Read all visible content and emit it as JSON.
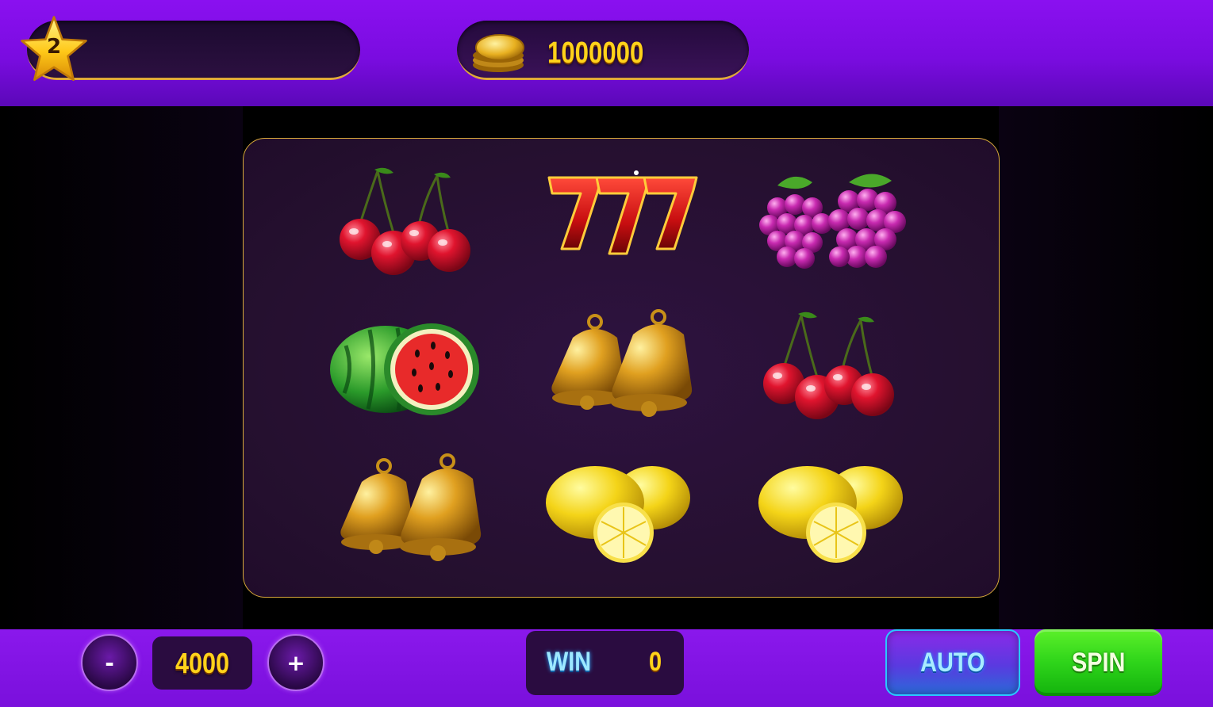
{
  "header": {
    "level": "2",
    "balance": "1000000"
  },
  "reels": {
    "symbols": [
      [
        "cherries",
        "sevens",
        "grapes"
      ],
      [
        "watermelon",
        "bells",
        "cherries"
      ],
      [
        "bells",
        "lemons",
        "lemons"
      ]
    ]
  },
  "controls": {
    "decrease_label": "-",
    "increase_label": "+",
    "bet": "4000",
    "win_label": "WIN",
    "win_value": "0",
    "auto_label": "AUTO",
    "spin_label": "SPIN"
  },
  "colors": {
    "accent_purple": "#8a10f0",
    "gold": "#ffd21a",
    "spin_green": "#2ed41a",
    "auto_blue": "#2ac8ff"
  }
}
